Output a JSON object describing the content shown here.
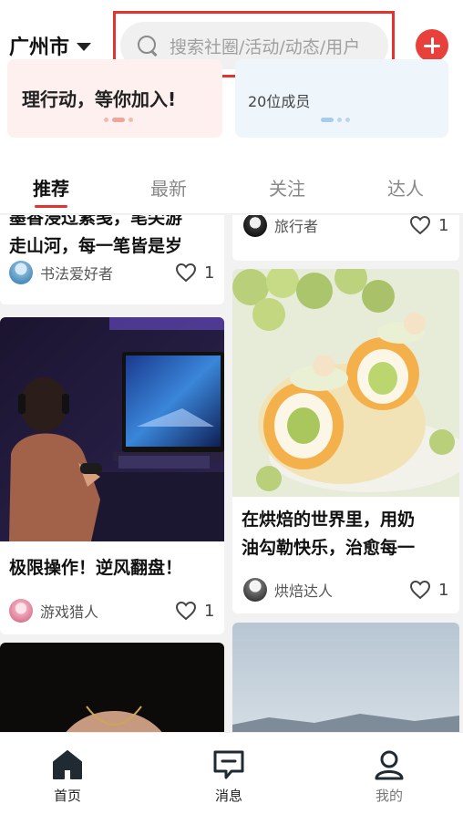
{
  "header": {
    "city": "广州市",
    "search_placeholder": "搜索社圈/活动/动态/用户"
  },
  "banners": [
    {
      "title": "理行动，等你加入!"
    },
    {
      "subtitle": "20位成员"
    }
  ],
  "tabs": [
    {
      "label": "推荐",
      "active": true
    },
    {
      "label": "最新"
    },
    {
      "label": "关注"
    },
    {
      "label": "达人"
    }
  ],
  "feed": {
    "col1": [
      {
        "title_lines": [
          "墨香浸过素笺，笔尖游",
          "走山河，每一笔皆是岁"
        ],
        "author": "书法爱好者",
        "likes": "1"
      },
      {
        "title": "极限操作！逆风翻盘！",
        "author": "游戏猎人",
        "likes": "1"
      }
    ],
    "col2": [
      {
        "author": "旅行者",
        "likes": "1"
      },
      {
        "title_lines": [
          "在烘焙的世界里，用奶",
          "油勾勒快乐，治愈每一"
        ],
        "author": "烘焙达人",
        "likes": "1"
      }
    ]
  },
  "bottom_nav": [
    {
      "label": "首页",
      "icon": "home-icon"
    },
    {
      "label": "消息",
      "icon": "message-icon"
    },
    {
      "label": "我的",
      "icon": "profile-icon"
    }
  ],
  "colors": {
    "accent": "#e2332e",
    "add_button": "#e8403b"
  }
}
